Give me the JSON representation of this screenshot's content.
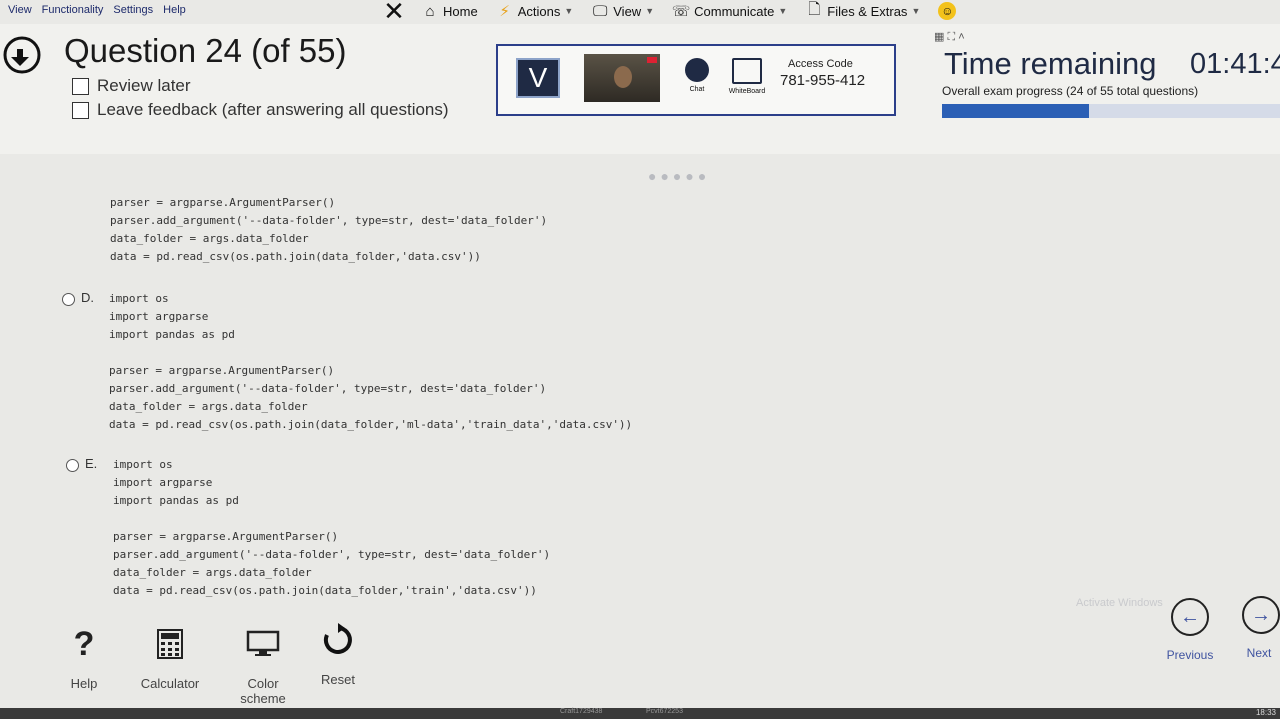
{
  "menubar": {
    "items": [
      "View",
      "Functionality",
      "Settings",
      "Help"
    ]
  },
  "toolbar": {
    "home": "Home",
    "actions": "Actions",
    "view": "View",
    "communicate": "Communicate",
    "files": "Files & Extras"
  },
  "header": {
    "question_title": "Question 24 (of 55)",
    "review_later": "Review later",
    "leave_feedback": "Leave feedback (after answering all questions)"
  },
  "video_panel": {
    "logo_letter": "V",
    "chat_label": "Chat",
    "whiteboard_label": "WhiteBoard",
    "access_label": "Access Code",
    "access_code": "781-955-412"
  },
  "timer": {
    "label": "Time remaining",
    "value": "01:41:4",
    "progress_text": "Overall exam progress (24 of 55 total questions)",
    "progress_fraction": 0.436
  },
  "options": {
    "prev_code": "parser = argparse.ArgumentParser()\nparser.add_argument('--data-folder', type=str, dest='data_folder')\ndata_folder = args.data_folder\ndata = pd.read_csv(os.path.join(data_folder,'data.csv'))",
    "D": {
      "letter": "D.",
      "code": "import os\nimport argparse\nimport pandas as pd\n\nparser = argparse.ArgumentParser()\nparser.add_argument('--data-folder', type=str, dest='data_folder')\ndata_folder = args.data_folder\ndata = pd.read_csv(os.path.join(data_folder,'ml-data','train_data','data.csv'))"
    },
    "E": {
      "letter": "E.",
      "code": "import os\nimport argparse\nimport pandas as pd\n\nparser = argparse.ArgumentParser()\nparser.add_argument('--data-folder', type=str, dest='data_folder')\ndata_folder = args.data_folder\ndata = pd.read_csv(os.path.join(data_folder,'train','data.csv'))"
    }
  },
  "tools": {
    "help": "Help",
    "calculator": "Calculator",
    "color_scheme": "Color scheme",
    "reset": "Reset"
  },
  "navigation": {
    "previous": "Previous",
    "next": "Next"
  },
  "watermark": "Activate Windows",
  "taskbar": {
    "clock": "18:33",
    "item1": "Craft1729438",
    "item2": "Pcvt672253"
  }
}
